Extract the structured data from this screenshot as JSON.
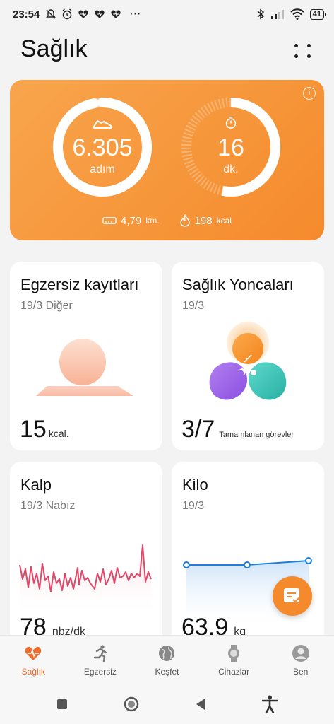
{
  "status_bar": {
    "time": "23:54",
    "notification_icons": [
      "mute-icon",
      "alarm-icon",
      "health-icon",
      "health-icon",
      "health-icon"
    ],
    "more_dots": "···",
    "battery_level": "41"
  },
  "header": {
    "title": "Sağlık"
  },
  "activity": {
    "steps_value": "6.305",
    "steps_unit": "adım",
    "steps_progress": 0.97,
    "time_value": "16",
    "time_unit": "dk.",
    "time_progress": 0.53,
    "distance_value": "4,79",
    "distance_unit": "km.",
    "calories_value": "198",
    "calories_unit": "kcal",
    "info_icon": "i"
  },
  "cards": {
    "exercise": {
      "title": "Egzersiz kayıtları",
      "subtitle": "19/3 Diğer",
      "value": "15",
      "unit": "kcal."
    },
    "clover": {
      "title": "Sağlık Yoncaları",
      "subtitle": "19/3",
      "value": "3/7",
      "unit": "Tamamlanan görevler"
    },
    "heart": {
      "title": "Kalp",
      "subtitle": "19/3 Nabız",
      "value": "78",
      "unit": "nbz/dk"
    },
    "weight": {
      "title": "Kilo",
      "subtitle": "19/3",
      "value": "63,9",
      "unit": "kg"
    }
  },
  "bottom_nav": [
    {
      "label": "Sağlık",
      "icon": "heart-icon",
      "active": true
    },
    {
      "label": "Egzersiz",
      "icon": "runner-icon",
      "active": false
    },
    {
      "label": "Keşfet",
      "icon": "globe-icon",
      "active": false
    },
    {
      "label": "Cihazlar",
      "icon": "watch-icon",
      "active": false
    },
    {
      "label": "Ben",
      "icon": "person-icon",
      "active": false
    }
  ],
  "colors": {
    "accent": "#f58a2c",
    "nav_active": "#f26b2a",
    "heart_line": "#e0486a",
    "weight_line": "#1e7fd6"
  }
}
